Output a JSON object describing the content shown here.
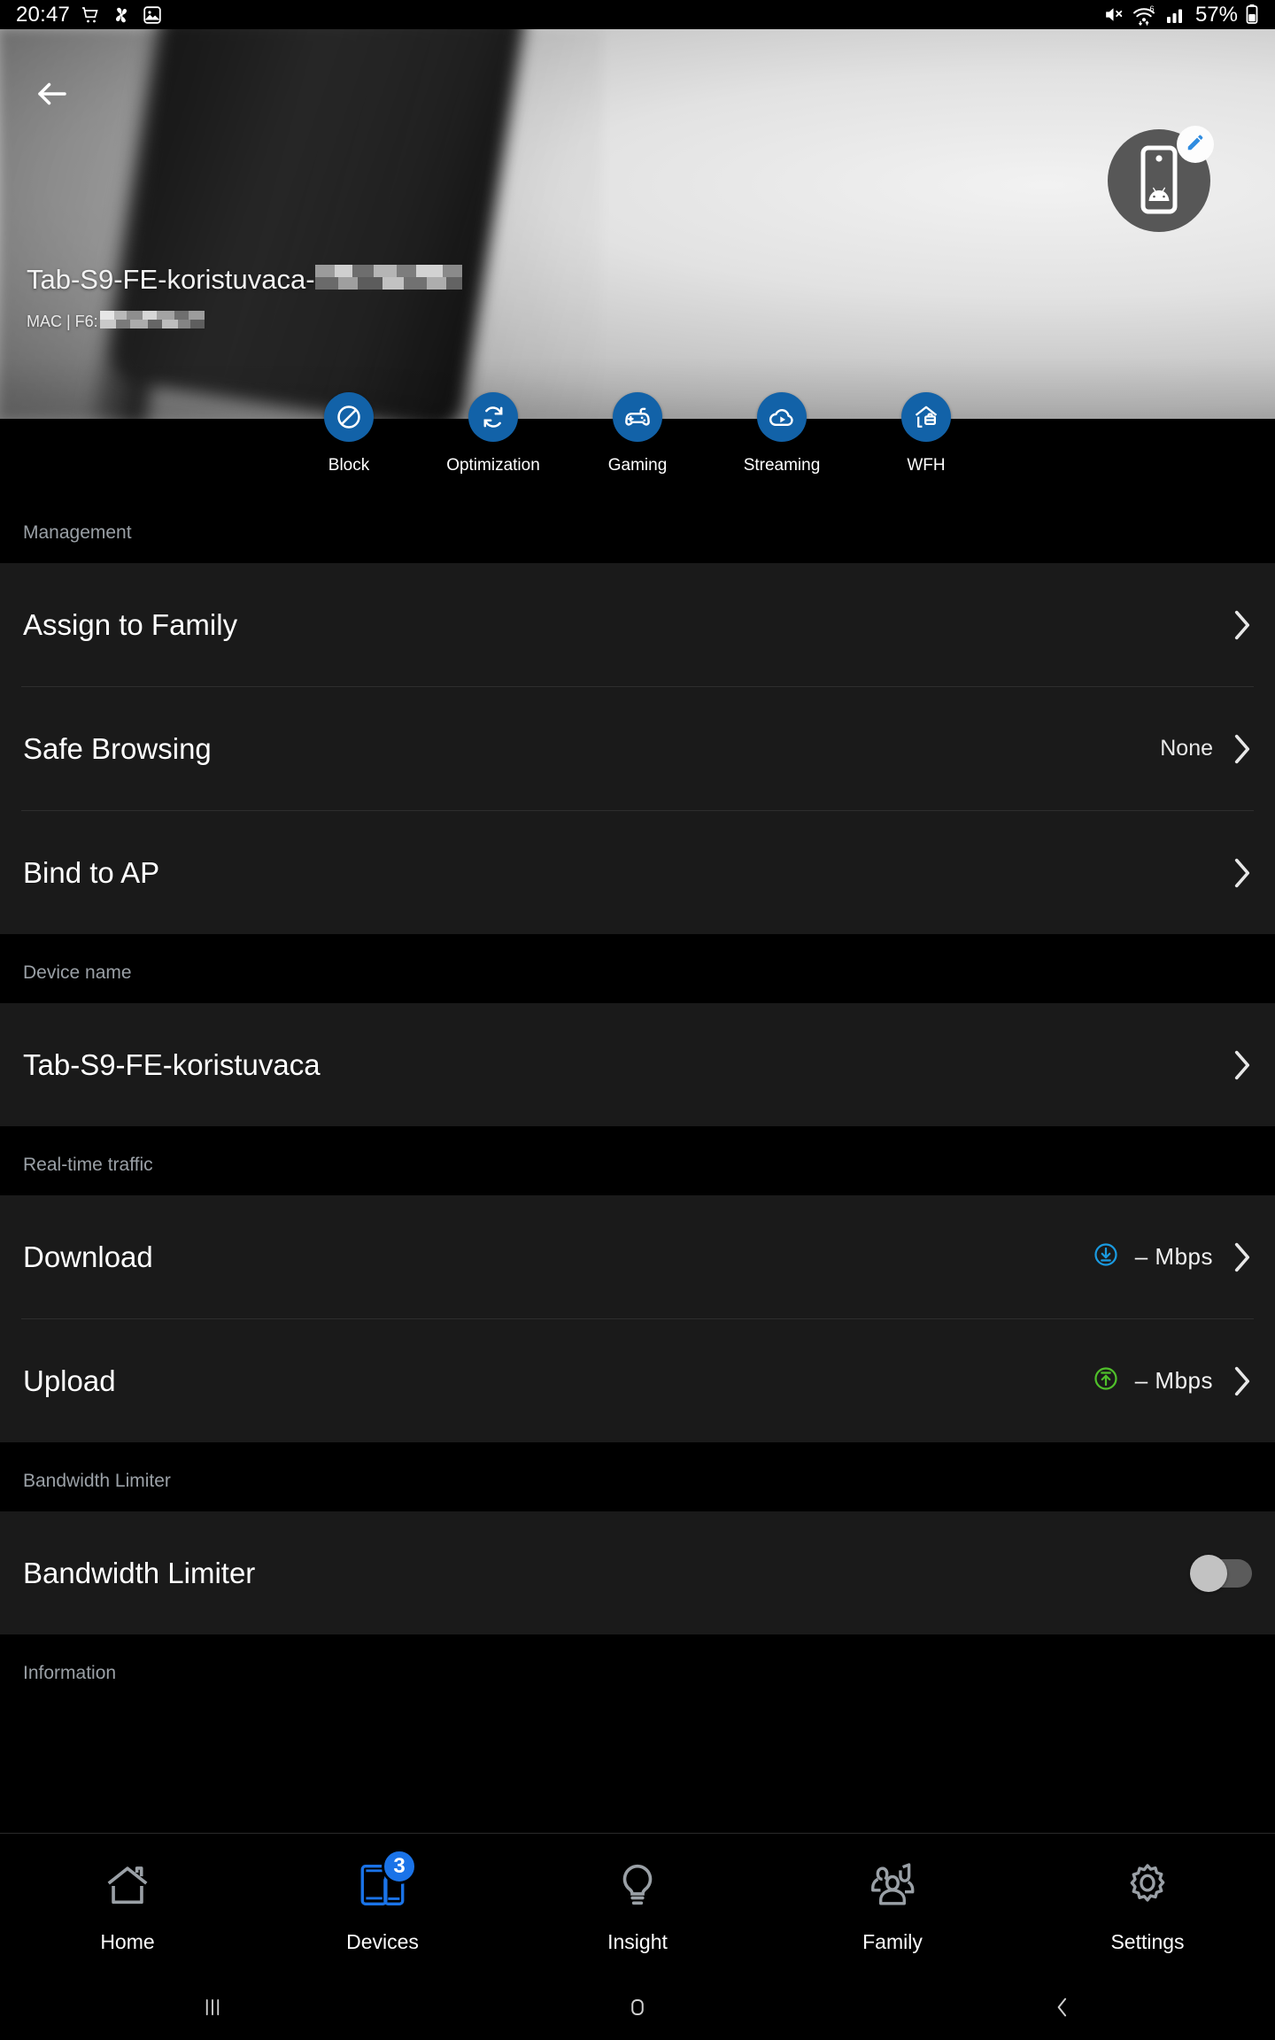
{
  "status_bar": {
    "time": "20:47",
    "battery_percent": "57%",
    "left_icons": [
      "shopping-cart-icon",
      "fan-icon",
      "image-icon"
    ],
    "right_icons": [
      "mute-icon",
      "wifi-6-icon",
      "signal-bars-icon",
      "battery-icon"
    ]
  },
  "hero": {
    "back_label": "back-arrow",
    "device_name_visible": "Tab-S9-FE-koristuvaca-",
    "device_name_redacted": true,
    "mac_label": "MAC | F6:",
    "mac_redacted": true,
    "avatar_icon": "android-phone-icon",
    "edit_badge_icon": "pencil-icon"
  },
  "quick_actions": [
    {
      "label": "Block",
      "icon": "block-icon"
    },
    {
      "label": "Optimization",
      "icon": "refresh-icon"
    },
    {
      "label": "Gaming",
      "icon": "gamepad-icon"
    },
    {
      "label": "Streaming",
      "icon": "cloud-play-icon"
    },
    {
      "label": "WFH",
      "icon": "house-briefcase-icon"
    }
  ],
  "sections": {
    "management": {
      "header": "Management",
      "rows": [
        {
          "title": "Assign to Family",
          "value": ""
        },
        {
          "title": "Safe Browsing",
          "value": "None"
        },
        {
          "title": "Bind to AP",
          "value": ""
        }
      ]
    },
    "device_name": {
      "header": "Device name",
      "rows": [
        {
          "title": "Tab-S9-FE-koristuvaca",
          "value": ""
        }
      ]
    },
    "realtime_traffic": {
      "header": "Real-time traffic",
      "download": {
        "title": "Download",
        "value": "–  Mbps",
        "icon": "download-circle-icon"
      },
      "upload": {
        "title": "Upload",
        "value": "–  Mbps",
        "icon": "upload-circle-icon"
      }
    },
    "bandwidth_limiter": {
      "header": "Bandwidth Limiter",
      "row_title": "Bandwidth Limiter",
      "toggle_on": false
    },
    "information": {
      "header": "Information"
    }
  },
  "bottom_nav": [
    {
      "label": "Home",
      "icon": "home-icon",
      "active": false,
      "badge": ""
    },
    {
      "label": "Devices",
      "icon": "devices-icon",
      "active": true,
      "badge": "3"
    },
    {
      "label": "Insight",
      "icon": "lightbulb-icon",
      "active": false,
      "badge": ""
    },
    {
      "label": "Family",
      "icon": "family-icon",
      "active": false,
      "badge": ""
    },
    {
      "label": "Settings",
      "icon": "gear-icon",
      "active": false,
      "badge": ""
    }
  ],
  "android_nav": [
    "recents-icon",
    "home-icon",
    "back-icon"
  ],
  "colors": {
    "accent_blue": "#1262a8",
    "nav_active_blue": "#1a73e8",
    "download_blue": "#1a9ae0",
    "upload_green": "#4fbf2a",
    "card_bg": "#1a1a1a",
    "page_bg": "#000000",
    "section_header_gray": "#9aa0a6"
  }
}
